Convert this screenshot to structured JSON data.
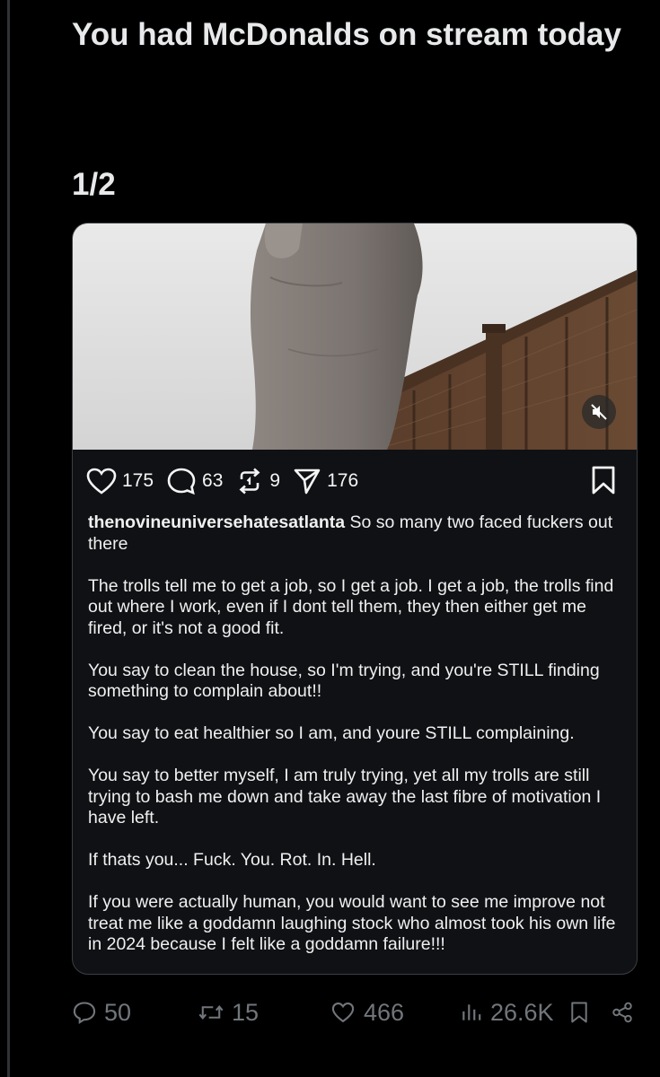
{
  "tweet": {
    "text": "You had McDonalds on stream today",
    "counter": "1/2"
  },
  "card": {
    "icons": {
      "mute": "speaker-muted-icon",
      "like": "heart-icon",
      "comment": "comment-bubble-icon",
      "repost": "repost-icon",
      "share": "send-icon",
      "save": "bookmark-icon"
    },
    "actions": {
      "likes": "175",
      "comments": "63",
      "reposts": "9",
      "shares": "176"
    },
    "caption": {
      "username": "thenovineuniversehatesatlanta",
      "first_line": "So so many two faced fuckers out there",
      "paragraphs": [
        "The trolls tell me to get a job, so I get a job. I get a job, the trolls find out where I work, even if I dont tell them, they then either get me fired, or it's not a good fit.",
        "You say to clean the house, so I'm trying, and you're STILL finding something to complain about!!",
        "You say to eat healthier so I am, and youre STILL complaining.",
        "You say to better myself, I am truly trying, yet all my trolls are still trying to bash me down and take away the last fibre of motivation I have left.",
        "If thats you... Fuck. You. Rot. In. Hell.",
        "If you were actually human, you would want to see me improve not treat me like a goddamn laughing stock who almost took his own life in 2024 because I felt like a goddamn failure!!!"
      ]
    }
  },
  "footer": {
    "replies": "50",
    "retweets": "15",
    "likes": "466",
    "views": "26.6K",
    "icons": [
      "reply-icon",
      "retweet-icon",
      "like-icon",
      "views-icon",
      "bookmark-icon",
      "share-icon"
    ]
  },
  "colors": {
    "background": "#000000",
    "card": "#0f1114",
    "text": "#e7e9ea",
    "muted": "#71767b"
  }
}
